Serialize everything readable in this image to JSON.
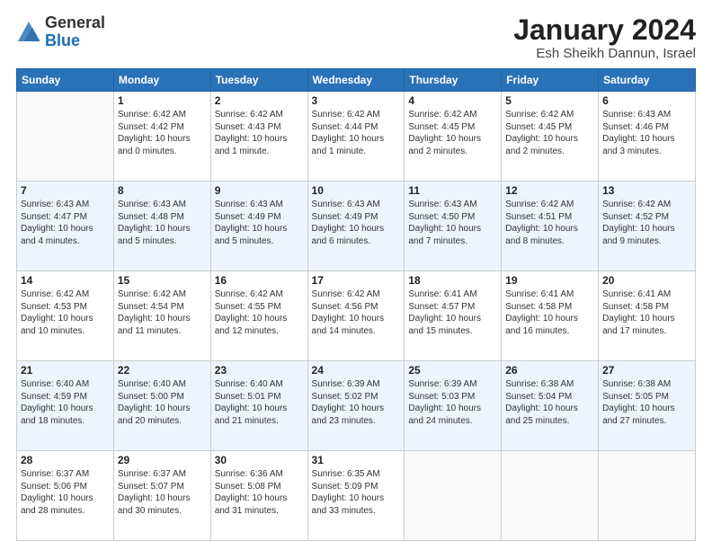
{
  "header": {
    "logo_general": "General",
    "logo_blue": "Blue",
    "month_title": "January 2024",
    "location": "Esh Sheikh Dannun, Israel"
  },
  "weekdays": [
    "Sunday",
    "Monday",
    "Tuesday",
    "Wednesday",
    "Thursday",
    "Friday",
    "Saturday"
  ],
  "weeks": [
    {
      "rowClass": "row-white",
      "days": [
        {
          "num": "",
          "info": ""
        },
        {
          "num": "1",
          "info": "Sunrise: 6:42 AM\nSunset: 4:42 PM\nDaylight: 10 hours\nand 0 minutes."
        },
        {
          "num": "2",
          "info": "Sunrise: 6:42 AM\nSunset: 4:43 PM\nDaylight: 10 hours\nand 1 minute."
        },
        {
          "num": "3",
          "info": "Sunrise: 6:42 AM\nSunset: 4:44 PM\nDaylight: 10 hours\nand 1 minute."
        },
        {
          "num": "4",
          "info": "Sunrise: 6:42 AM\nSunset: 4:45 PM\nDaylight: 10 hours\nand 2 minutes."
        },
        {
          "num": "5",
          "info": "Sunrise: 6:42 AM\nSunset: 4:45 PM\nDaylight: 10 hours\nand 2 minutes."
        },
        {
          "num": "6",
          "info": "Sunrise: 6:43 AM\nSunset: 4:46 PM\nDaylight: 10 hours\nand 3 minutes."
        }
      ]
    },
    {
      "rowClass": "row-alt",
      "days": [
        {
          "num": "7",
          "info": "Sunrise: 6:43 AM\nSunset: 4:47 PM\nDaylight: 10 hours\nand 4 minutes."
        },
        {
          "num": "8",
          "info": "Sunrise: 6:43 AM\nSunset: 4:48 PM\nDaylight: 10 hours\nand 5 minutes."
        },
        {
          "num": "9",
          "info": "Sunrise: 6:43 AM\nSunset: 4:49 PM\nDaylight: 10 hours\nand 5 minutes."
        },
        {
          "num": "10",
          "info": "Sunrise: 6:43 AM\nSunset: 4:49 PM\nDaylight: 10 hours\nand 6 minutes."
        },
        {
          "num": "11",
          "info": "Sunrise: 6:43 AM\nSunset: 4:50 PM\nDaylight: 10 hours\nand 7 minutes."
        },
        {
          "num": "12",
          "info": "Sunrise: 6:42 AM\nSunset: 4:51 PM\nDaylight: 10 hours\nand 8 minutes."
        },
        {
          "num": "13",
          "info": "Sunrise: 6:42 AM\nSunset: 4:52 PM\nDaylight: 10 hours\nand 9 minutes."
        }
      ]
    },
    {
      "rowClass": "row-white",
      "days": [
        {
          "num": "14",
          "info": "Sunrise: 6:42 AM\nSunset: 4:53 PM\nDaylight: 10 hours\nand 10 minutes."
        },
        {
          "num": "15",
          "info": "Sunrise: 6:42 AM\nSunset: 4:54 PM\nDaylight: 10 hours\nand 11 minutes."
        },
        {
          "num": "16",
          "info": "Sunrise: 6:42 AM\nSunset: 4:55 PM\nDaylight: 10 hours\nand 12 minutes."
        },
        {
          "num": "17",
          "info": "Sunrise: 6:42 AM\nSunset: 4:56 PM\nDaylight: 10 hours\nand 14 minutes."
        },
        {
          "num": "18",
          "info": "Sunrise: 6:41 AM\nSunset: 4:57 PM\nDaylight: 10 hours\nand 15 minutes."
        },
        {
          "num": "19",
          "info": "Sunrise: 6:41 AM\nSunset: 4:58 PM\nDaylight: 10 hours\nand 16 minutes."
        },
        {
          "num": "20",
          "info": "Sunrise: 6:41 AM\nSunset: 4:58 PM\nDaylight: 10 hours\nand 17 minutes."
        }
      ]
    },
    {
      "rowClass": "row-alt",
      "days": [
        {
          "num": "21",
          "info": "Sunrise: 6:40 AM\nSunset: 4:59 PM\nDaylight: 10 hours\nand 18 minutes."
        },
        {
          "num": "22",
          "info": "Sunrise: 6:40 AM\nSunset: 5:00 PM\nDaylight: 10 hours\nand 20 minutes."
        },
        {
          "num": "23",
          "info": "Sunrise: 6:40 AM\nSunset: 5:01 PM\nDaylight: 10 hours\nand 21 minutes."
        },
        {
          "num": "24",
          "info": "Sunrise: 6:39 AM\nSunset: 5:02 PM\nDaylight: 10 hours\nand 23 minutes."
        },
        {
          "num": "25",
          "info": "Sunrise: 6:39 AM\nSunset: 5:03 PM\nDaylight: 10 hours\nand 24 minutes."
        },
        {
          "num": "26",
          "info": "Sunrise: 6:38 AM\nSunset: 5:04 PM\nDaylight: 10 hours\nand 25 minutes."
        },
        {
          "num": "27",
          "info": "Sunrise: 6:38 AM\nSunset: 5:05 PM\nDaylight: 10 hours\nand 27 minutes."
        }
      ]
    },
    {
      "rowClass": "row-white",
      "days": [
        {
          "num": "28",
          "info": "Sunrise: 6:37 AM\nSunset: 5:06 PM\nDaylight: 10 hours\nand 28 minutes."
        },
        {
          "num": "29",
          "info": "Sunrise: 6:37 AM\nSunset: 5:07 PM\nDaylight: 10 hours\nand 30 minutes."
        },
        {
          "num": "30",
          "info": "Sunrise: 6:36 AM\nSunset: 5:08 PM\nDaylight: 10 hours\nand 31 minutes."
        },
        {
          "num": "31",
          "info": "Sunrise: 6:35 AM\nSunset: 5:09 PM\nDaylight: 10 hours\nand 33 minutes."
        },
        {
          "num": "",
          "info": ""
        },
        {
          "num": "",
          "info": ""
        },
        {
          "num": "",
          "info": ""
        }
      ]
    }
  ]
}
